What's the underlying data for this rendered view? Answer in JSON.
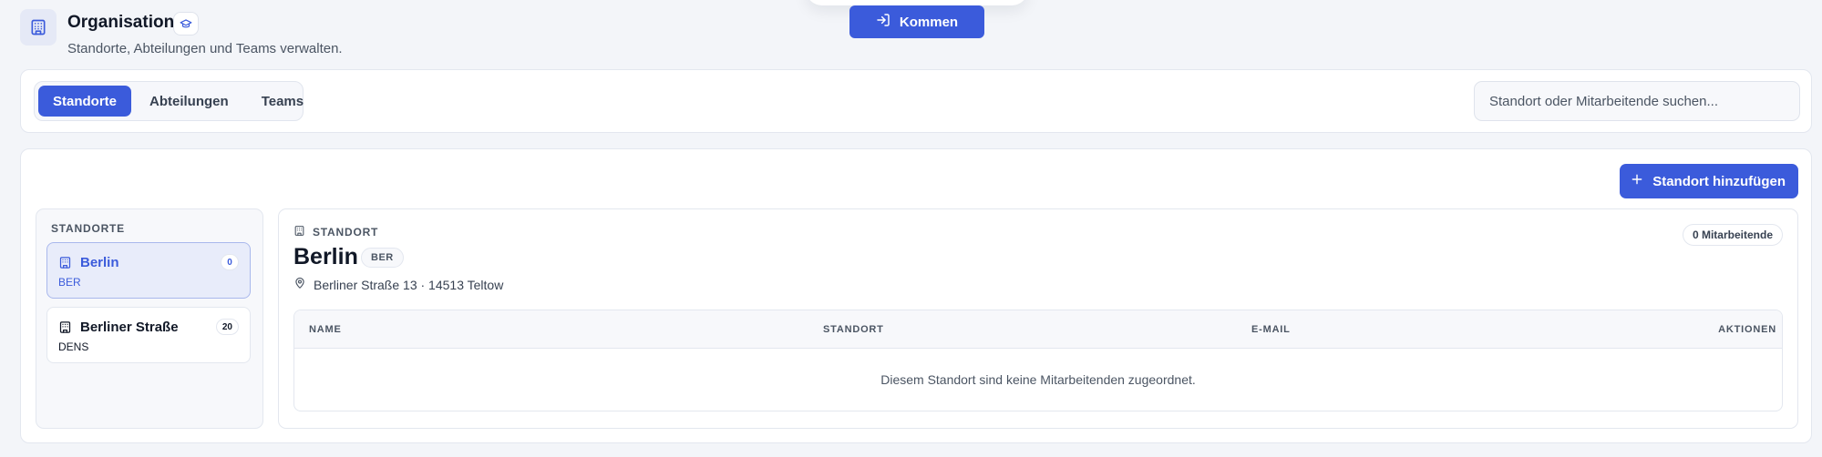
{
  "clock": {
    "label": "Kommen"
  },
  "header": {
    "title": "Organisation",
    "subtitle": "Standorte, Abteilungen und Teams verwalten."
  },
  "tabs": [
    {
      "label": "Standorte",
      "active": true
    },
    {
      "label": "Abteilungen",
      "active": false
    },
    {
      "label": "Teams",
      "active": false
    }
  ],
  "search": {
    "placeholder": "Standort oder Mitarbeitende suchen..."
  },
  "actions": {
    "add_location": "Standort hinzufügen"
  },
  "locations": {
    "heading": "STANDORTE",
    "items": [
      {
        "name": "Berlin",
        "code": "BER",
        "count": "0",
        "selected": true
      },
      {
        "name": "Berliner Straße",
        "code": "DENS",
        "count": "20",
        "selected": false
      }
    ]
  },
  "detail": {
    "kicker": "STANDORT",
    "name": "Berlin",
    "code": "BER",
    "address": "Berliner Straße 13 · 14513 Teltow",
    "employee_badge": "0 Mitarbeitende",
    "table": {
      "columns": [
        "NAME",
        "STANDORT",
        "E-MAIL",
        "AKTIONEN"
      ],
      "empty_message": "Diesem Standort sind keine Mitarbeitenden zugeordnet."
    }
  },
  "colors": {
    "accent": "#3b5bdb",
    "page_background": "#f3f5f9",
    "selected_background": "#e8ecfa"
  },
  "icons": {
    "header": "building-icon",
    "badge": "graduation-cap-icon",
    "clock": "login-icon",
    "add": "plus-icon",
    "address": "map-pin-icon"
  }
}
